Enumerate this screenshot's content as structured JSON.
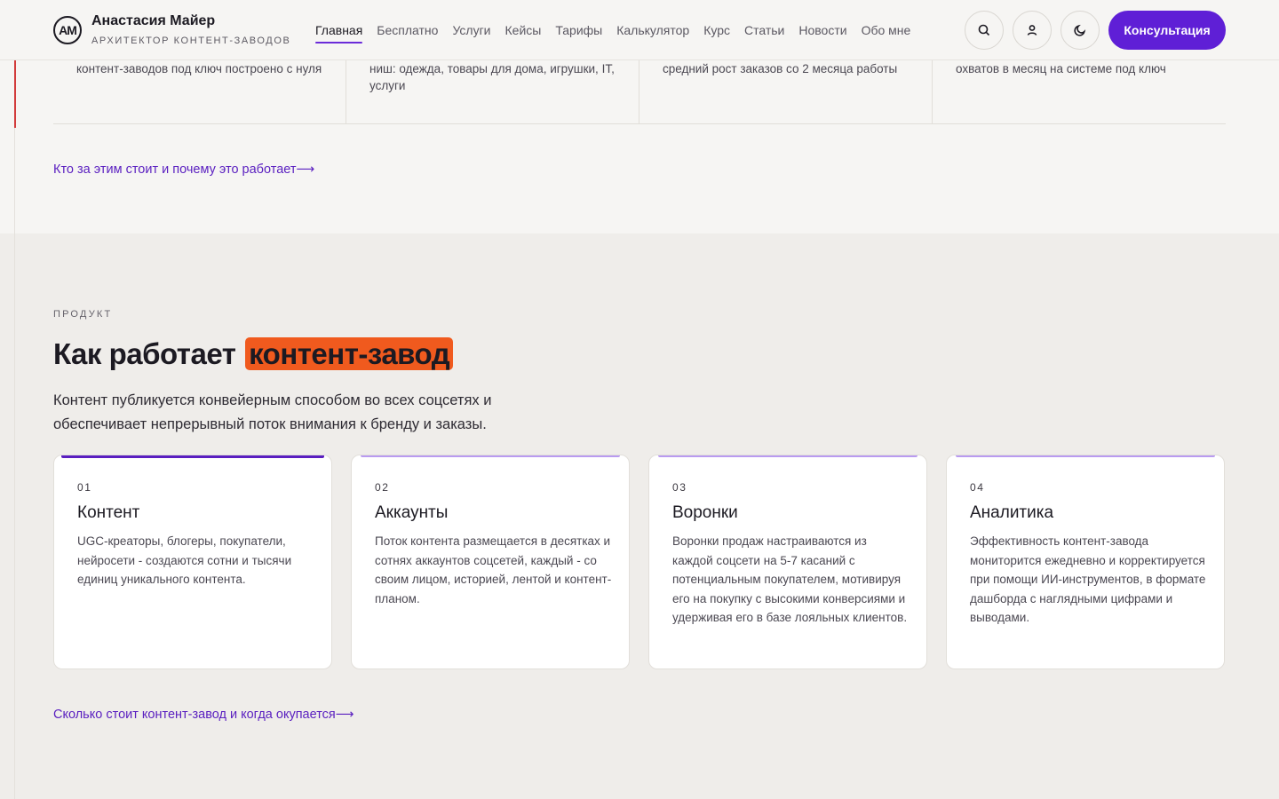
{
  "header": {
    "logo_mark": "AM",
    "brand_name": "Анастасия Майер",
    "brand_subtitle": "АРХИТЕКТОР КОНТЕНТ-ЗАВОДОВ",
    "nav": [
      {
        "label": "Главная",
        "active": true
      },
      {
        "label": "Бесплатно",
        "active": false
      },
      {
        "label": "Услуги",
        "active": false
      },
      {
        "label": "Кейсы",
        "active": false
      },
      {
        "label": "Тарифы",
        "active": false
      },
      {
        "label": "Калькулятор",
        "active": false
      },
      {
        "label": "Курс",
        "active": false
      },
      {
        "label": "Статьи",
        "active": false
      },
      {
        "label": "Новости",
        "active": false
      },
      {
        "label": "Обо мне",
        "active": false
      }
    ],
    "icons": [
      "search-icon",
      "user-icon",
      "moon-icon"
    ],
    "cta_label": "Консультация",
    "accent_color": "#5f1fd6"
  },
  "stats": {
    "items": [
      {
        "text": "контент-заводов под ключ построено с нуля"
      },
      {
        "text": "ниш: одежда, товары для дома, игрушки, IT, услуги"
      },
      {
        "text": "средний рост заказов со 2 месяца работы"
      },
      {
        "text": "охватов в месяц на системе под ключ"
      }
    ],
    "link": "Кто за этим стоит и почему это работает⟶"
  },
  "product": {
    "eyebrow": "ПРОДУКТ",
    "headline_plain": "Как работает",
    "headline_highlight": "контент-завод",
    "highlight_color": "#f05a1e",
    "lead": "Контент публикуется конвейерным способом во всех соцсетях и обеспечивает непрерывный поток внимания к бренду и заказы.",
    "cards": [
      {
        "num": "01",
        "title": "Контент",
        "text": "UGC-креаторы, блогеры, покупатели, нейросети - создаются сотни и тысячи единиц уникального контента."
      },
      {
        "num": "02",
        "title": "Аккаунты",
        "text": "Поток контента размещается в десятках и сотнях аккаунтов соцсетей, каждый - со своим лицом, историей, лентой и контент-планом."
      },
      {
        "num": "03",
        "title": "Воронки",
        "text": "Воронки продаж настраиваются из каждой соцсети на 5-7 касаний с потенциальным покупателем, мотивируя его на покупку с высокими конверсиями и удерживая его в базе лояльных клиентов."
      },
      {
        "num": "04",
        "title": "Аналитика",
        "text": "Эффективность контент-завода мониторится ежедневно и корректируется при помощи ИИ-инструментов, в формате дашборда с наглядными цифрами и выводами."
      }
    ],
    "link": "Сколько стоит контент-завод и когда окупается⟶"
  }
}
